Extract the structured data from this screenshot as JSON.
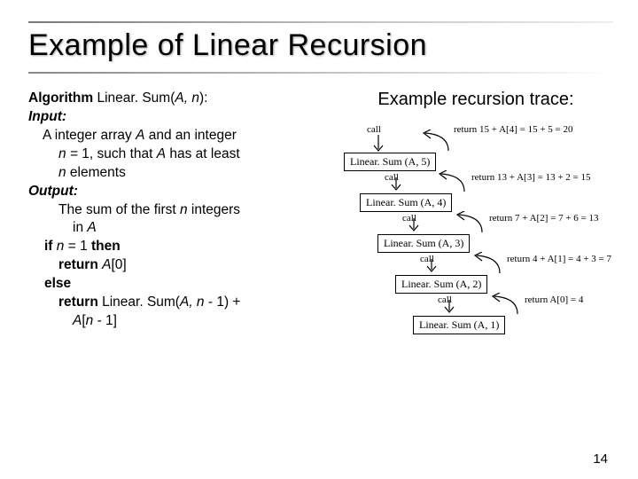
{
  "title": "Example of Linear Recursion",
  "pagenum": "14",
  "algo": {
    "kw_algorithm": "Algorithm",
    "sig1": " Linear. Sum(",
    "sig2": "A, n",
    "sig3": "):",
    "kw_input": "Input:",
    "input1a": "A integer array ",
    "input1b": "A",
    "input1c": " and an integer",
    "input2a": "n =",
    "input2b": " 1, such that ",
    "input2c": "A",
    "input2d": " has at least",
    "input3a": "n",
    "input3b": " elements",
    "kw_output": "Output:",
    "out1a": "The sum of the first ",
    "out1b": "n",
    "out1c": " integers",
    "out2a": "in ",
    "out2b": "A",
    "if1a": "if ",
    "if1b": "n",
    "if1c": " = 1 ",
    "if1d": "then",
    "ret1a": "return ",
    "ret1b": "A",
    "ret1c": "[0]",
    "else": "else",
    "ret2a": "return ",
    "ret2b": "Linear. Sum(",
    "ret2c": "A, n",
    "ret2d": " - 1) +",
    "ret3a": "A",
    "ret3b": "[",
    "ret3c": "n",
    "ret3d": " - 1]"
  },
  "trace": {
    "heading": "Example recursion trace:",
    "call": "call",
    "box5": "Linear. Sum (A, 5)",
    "box4": "Linear. Sum (A, 4)",
    "box3": "Linear. Sum (A, 3)",
    "box2": "Linear. Sum (A, 2)",
    "box1": "Linear. Sum (A, 1)",
    "ret5": "return 15 + A[4] = 15 + 5 = 20",
    "ret4": "return 13 + A[3] = 13 + 2 = 15",
    "ret3": "return 7 + A[2] = 7 + 6 = 13",
    "ret2": "return 4 + A[1] = 4 + 3 = 7",
    "ret1": "return A[0] = 4"
  }
}
